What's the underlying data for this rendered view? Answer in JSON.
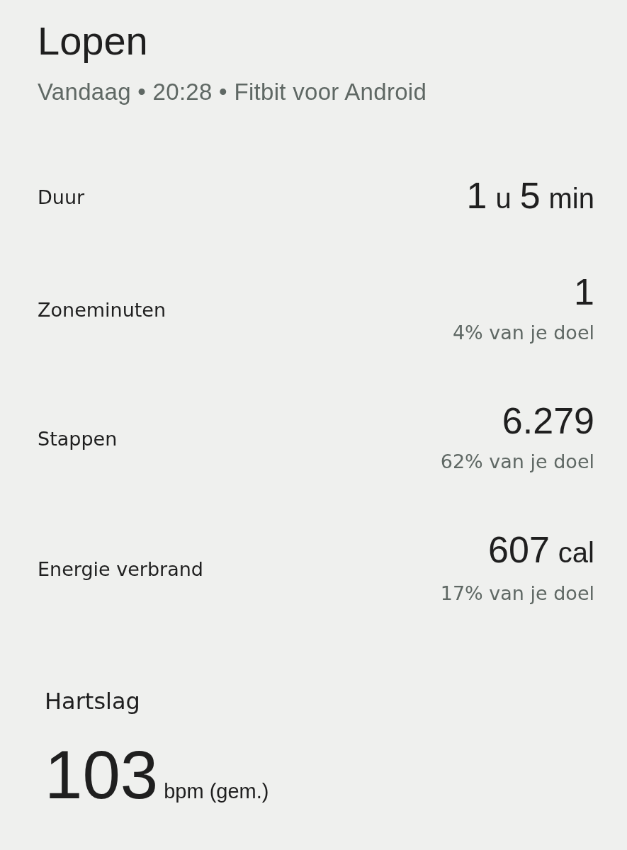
{
  "header": {
    "title": "Lopen",
    "subtitle": "Vandaag • 20:28 • Fitbit voor Android"
  },
  "stats": [
    {
      "label": "Duur",
      "value": [
        {
          "text": "1",
          "kind": "number"
        },
        {
          "text": "u",
          "kind": "unit"
        },
        {
          "text": "5",
          "kind": "number"
        },
        {
          "text": "min",
          "kind": "unit"
        }
      ]
    },
    {
      "label": "Zoneminuten",
      "value": [
        {
          "text": "1",
          "kind": "number"
        }
      ],
      "goal": "4% van je doel"
    },
    {
      "label": "Stappen",
      "value": [
        {
          "text": "6.279",
          "kind": "number"
        }
      ],
      "goal": "62% van je doel"
    },
    {
      "label": "Energie verbrand",
      "value": [
        {
          "text": "607",
          "kind": "number"
        },
        {
          "text": "cal",
          "kind": "unit"
        }
      ],
      "goal": "17% van je doel"
    }
  ],
  "heart_rate": {
    "title": "Hartslag",
    "value": "103",
    "unit": "bpm (gem.)"
  }
}
